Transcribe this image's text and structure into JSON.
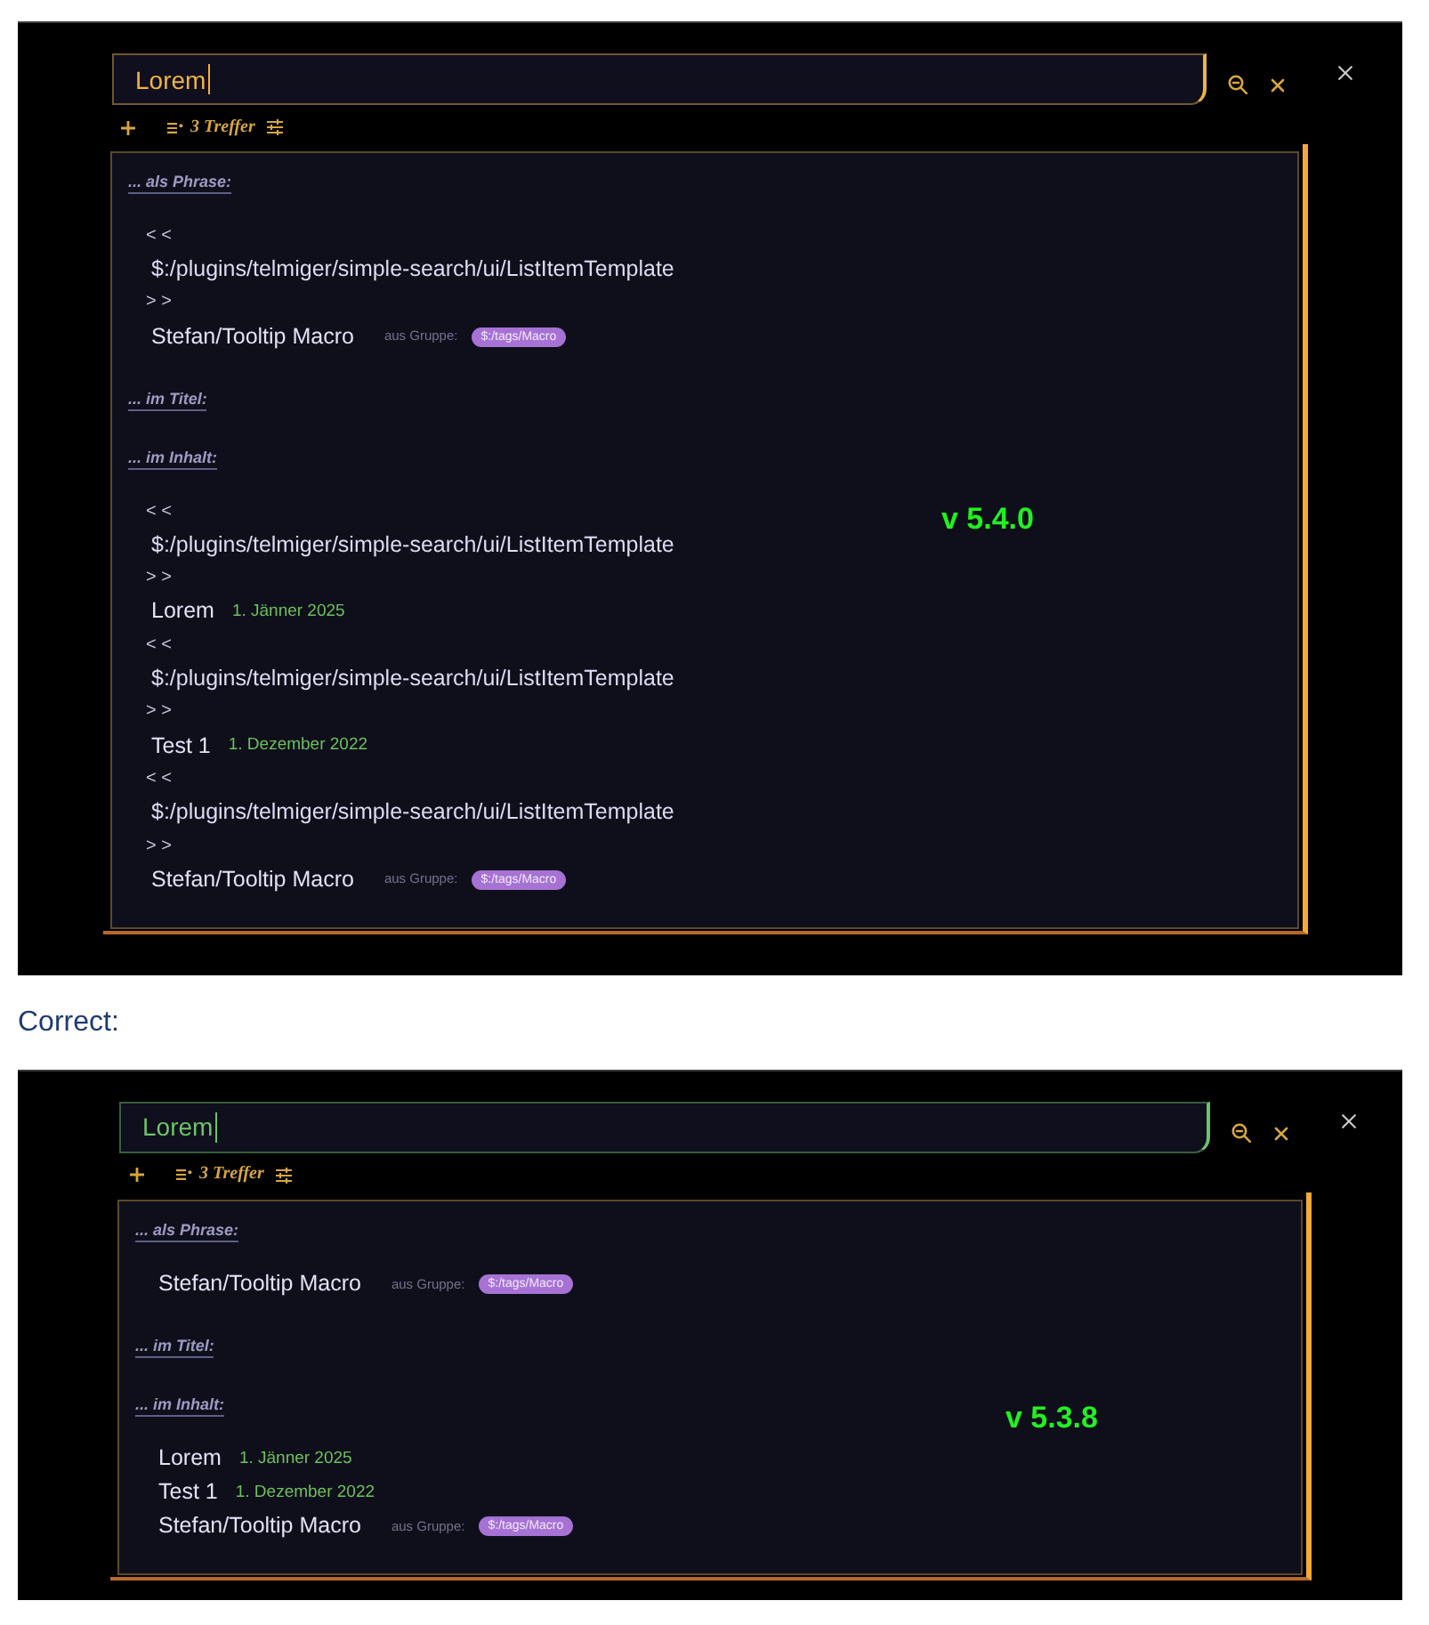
{
  "items": [
    {
      "kind": "screenshot",
      "version_label": "v 5.4.0",
      "search": {
        "value": "Lorem",
        "color": "#f0b247"
      },
      "toolbar": {
        "count": "3 Treffer"
      },
      "sections": [
        {
          "heading": "... als Phrase:",
          "lines": [
            {
              "kind": "marker",
              "text": "< <"
            },
            {
              "kind": "path",
              "text": "$:/plugins/telmiger/simple-search/ui/ListItemTemplate"
            },
            {
              "kind": "marker",
              "text": "> >"
            },
            {
              "kind": "result",
              "title": "Stefan/Tooltip Macro",
              "group_label": "aus Gruppe:",
              "tag": "$:/tags/Macro"
            }
          ]
        },
        {
          "heading": "... im Titel:"
        },
        {
          "heading": "... im Inhalt:",
          "lines": [
            {
              "kind": "marker",
              "text": "< <"
            },
            {
              "kind": "path",
              "text": "$:/plugins/telmiger/simple-search/ui/ListItemTemplate"
            },
            {
              "kind": "marker",
              "text": "> >"
            },
            {
              "kind": "result",
              "title": "Lorem",
              "date": "1. Jänner 2025"
            },
            {
              "kind": "marker",
              "text": "< <"
            },
            {
              "kind": "path",
              "text": "$:/plugins/telmiger/simple-search/ui/ListItemTemplate"
            },
            {
              "kind": "marker",
              "text": "> >"
            },
            {
              "kind": "result",
              "title": "Test 1",
              "date": "1. Dezember 2022"
            },
            {
              "kind": "marker",
              "text": "< <"
            },
            {
              "kind": "path",
              "text": "$:/plugins/telmiger/simple-search/ui/ListItemTemplate"
            },
            {
              "kind": "marker",
              "text": "> >"
            },
            {
              "kind": "result",
              "title": "Stefan/Tooltip Macro",
              "group_label": "aus Gruppe:",
              "tag": "$:/tags/Macro"
            }
          ]
        }
      ]
    },
    {
      "kind": "caption",
      "text": "Correct:"
    },
    {
      "kind": "screenshot",
      "version_label": "v 5.3.8",
      "search": {
        "value": "Lorem",
        "color": "#6cc36a"
      },
      "toolbar": {
        "count": "3 Treffer"
      },
      "sections": [
        {
          "heading": "... als Phrase:",
          "lines": [
            {
              "kind": "result",
              "title": "Stefan/Tooltip Macro",
              "group_label": "aus Gruppe:",
              "tag": "$:/tags/Macro"
            }
          ]
        },
        {
          "heading": "... im Titel:"
        },
        {
          "heading": "... im Inhalt:",
          "lines": [
            {
              "kind": "result",
              "title": "Lorem",
              "date": "1. Jänner 2025"
            },
            {
              "kind": "result",
              "title": "Test 1",
              "date": "1. Dezember 2022"
            },
            {
              "kind": "result",
              "title": "Stefan/Tooltip Macro",
              "group_label": "aus Gruppe:",
              "tag": "$:/tags/Macro"
            }
          ]
        }
      ]
    }
  ]
}
